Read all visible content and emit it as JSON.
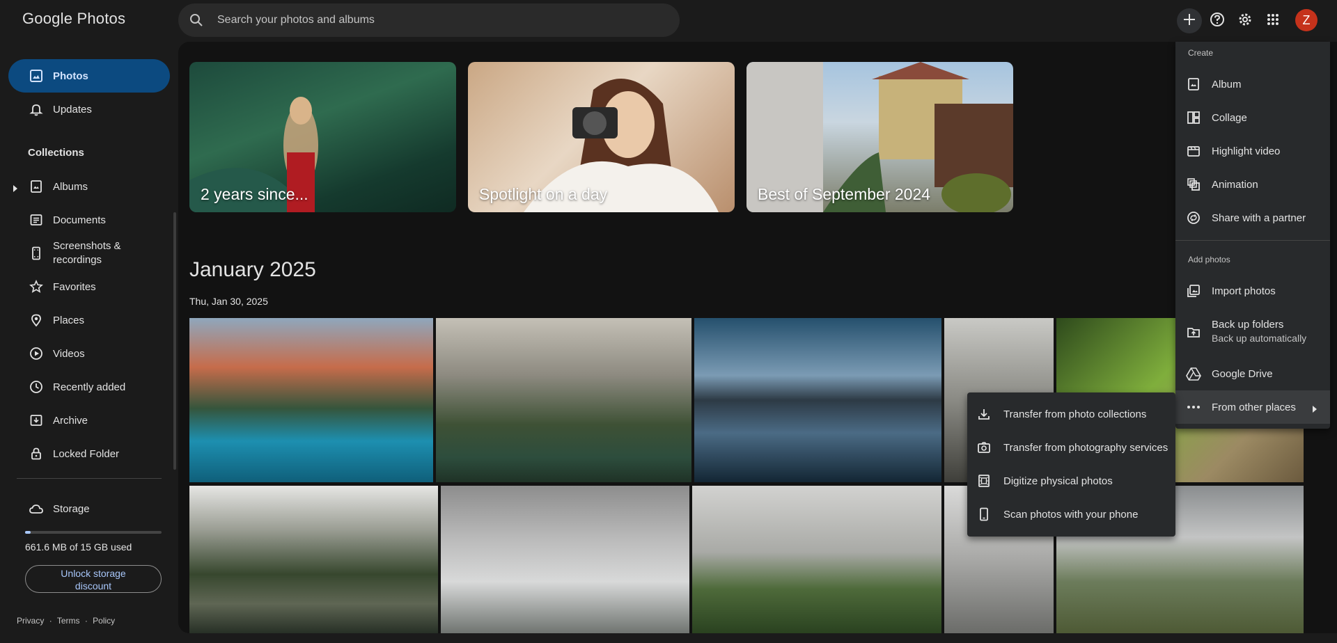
{
  "app": {
    "logo_google": "Google",
    "logo_photos": "Photos"
  },
  "search": {
    "placeholder": "Search your photos and albums"
  },
  "header": {
    "avatar_letter": "Z"
  },
  "sidebar": {
    "items": [
      {
        "label": "Photos",
        "icon": "photo-icon"
      },
      {
        "label": "Updates",
        "icon": "bell-icon"
      }
    ],
    "collections_title": "Collections",
    "collections": [
      {
        "label": "Albums",
        "icon": "album-icon"
      },
      {
        "label": "Documents",
        "icon": "document-icon"
      },
      {
        "label": "Screenshots & recordings",
        "icon": "phone-screenshot-icon"
      },
      {
        "label": "Favorites",
        "icon": "star-icon"
      },
      {
        "label": "Places",
        "icon": "pin-icon"
      },
      {
        "label": "Videos",
        "icon": "play-icon"
      },
      {
        "label": "Recently added",
        "icon": "clock-icon"
      },
      {
        "label": "Archive",
        "icon": "archive-icon"
      },
      {
        "label": "Locked Folder",
        "icon": "lock-icon"
      }
    ],
    "storage": {
      "label": "Storage",
      "used_text": "661.6 MB of 15 GB used",
      "used_fraction": 0.04,
      "unlock_label": "Unlock storage discount"
    },
    "footer": {
      "privacy": "Privacy",
      "terms": "Terms",
      "policy": "Policy",
      "sep": "·"
    }
  },
  "memories": [
    {
      "title": "2 years since..."
    },
    {
      "title": "Spotlight on a day"
    },
    {
      "title": "Best of September 2024"
    }
  ],
  "timeline": {
    "month": "January 2025",
    "date": "Thu, Jan 30, 2025"
  },
  "create_menu": {
    "create_title": "Create",
    "create_items": [
      {
        "label": "Album",
        "icon": "album-icon"
      },
      {
        "label": "Collage",
        "icon": "collage-icon"
      },
      {
        "label": "Highlight video",
        "icon": "movie-icon"
      },
      {
        "label": "Animation",
        "icon": "animation-icon"
      },
      {
        "label": "Share with a partner",
        "icon": "partner-share-icon"
      }
    ],
    "add_title": "Add photos",
    "add_items": [
      {
        "label": "Import photos",
        "icon": "import-icon"
      },
      {
        "label": "Back up folders",
        "sublabel": "Back up automatically",
        "icon": "folder-upload-icon"
      },
      {
        "label": "Google Drive",
        "icon": "drive-icon"
      },
      {
        "label": "From other places",
        "icon": "more-horiz-icon"
      }
    ]
  },
  "submenu": {
    "items": [
      {
        "label": "Transfer from photo collections",
        "icon": "download-icon"
      },
      {
        "label": "Transfer from photography services",
        "icon": "camera-transfer-icon"
      },
      {
        "label": "Digitize physical photos",
        "icon": "film-scan-icon"
      },
      {
        "label": "Scan photos with your phone",
        "icon": "phone-icon"
      }
    ]
  },
  "colors": {
    "accent": "#0c4a80",
    "avatar": "#c5321b",
    "link": "#a8c7fa"
  }
}
